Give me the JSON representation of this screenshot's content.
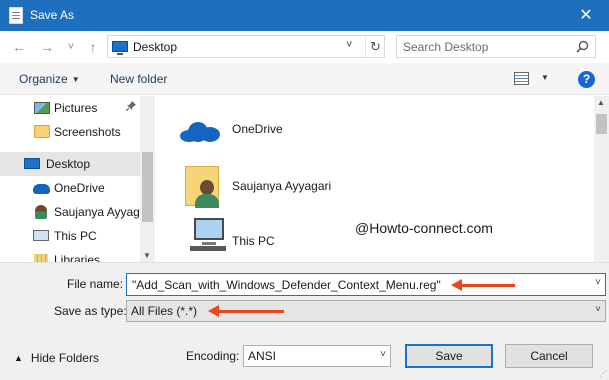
{
  "window": {
    "title": "Save As",
    "close_glyph": "✕"
  },
  "nav": {
    "back_glyph": "←",
    "forward_glyph": "→",
    "recent_glyph": "˅",
    "up_glyph": "↑",
    "address": "Desktop",
    "address_chevron": "˅",
    "refresh_glyph": "↻",
    "search_placeholder": "Search Desktop"
  },
  "toolbar": {
    "organize_label": "Organize",
    "new_folder_label": "New folder",
    "help_label": "?",
    "caret": "▼"
  },
  "sidebar": {
    "items": [
      {
        "label": "Pictures",
        "icon": "pictures-icon",
        "pinned": true
      },
      {
        "label": "Screenshots",
        "icon": "folder-icon"
      },
      {
        "label": "Desktop",
        "icon": "desktop-icon",
        "selected": true
      },
      {
        "label": "OneDrive",
        "icon": "onedrive-icon"
      },
      {
        "label": "Saujanya Ayyagari",
        "icon": "user-icon"
      },
      {
        "label": "This PC",
        "icon": "computer-icon"
      },
      {
        "label": "Libraries",
        "icon": "libraries-icon"
      }
    ],
    "pin_glyph": "📌"
  },
  "content": {
    "items": [
      {
        "label": "OneDrive",
        "icon": "onedrive-icon"
      },
      {
        "label": "Saujanya Ayyagari",
        "icon": "user-folder-icon"
      },
      {
        "label": "This PC",
        "icon": "computer-icon"
      }
    ],
    "watermark": "@Howto-connect.com"
  },
  "form": {
    "file_name_label": "File name:",
    "file_name_value": "\"Add_Scan_with_Windows_Defender_Context_Menu.reg\"",
    "save_type_label": "Save as type:",
    "save_type_value": "All Files  (*.*)",
    "hide_folders_label": "Hide Folders",
    "hide_caret": "▲",
    "encoding_label": "Encoding:",
    "encoding_value": "ANSI",
    "save_label": "Save",
    "cancel_label": "Cancel",
    "chevron": "˅"
  },
  "colors": {
    "titlebar": "#1f6fbf",
    "accent": "#1a73c9",
    "annotation_arrow": "#e8461c"
  }
}
